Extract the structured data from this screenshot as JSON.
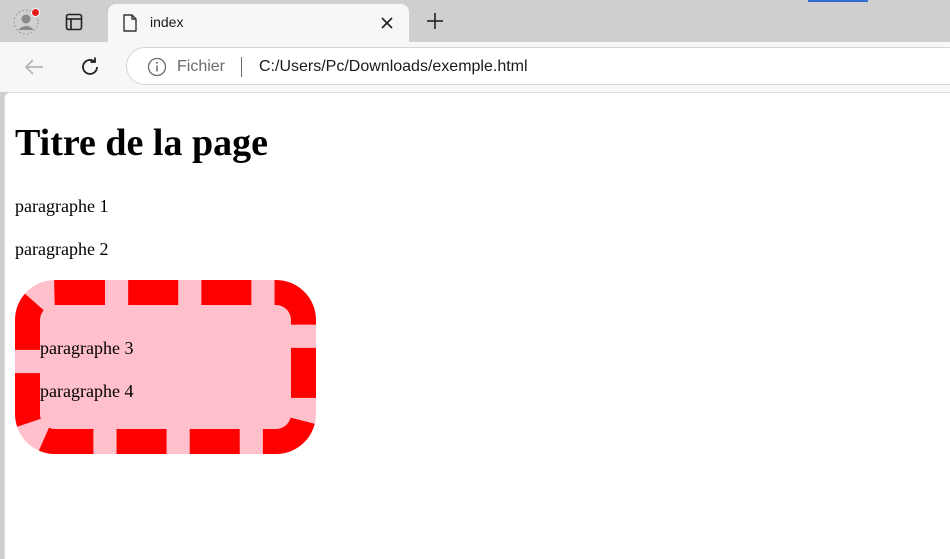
{
  "tab": {
    "title": "index"
  },
  "address_bar": {
    "site_label": "Fichier",
    "url": "C:/Users/Pc/Downloads/exemple.html"
  },
  "page": {
    "title": "Titre de la page",
    "paragraphs": [
      "paragraphe 1",
      "paragraphe 2"
    ],
    "box": {
      "paragraphs": [
        "paragraphe 3",
        "paragraphe 4"
      ],
      "background_color": "#ffc0cb",
      "border_color": "#ff0000"
    }
  },
  "icons": {
    "profile": "profile-icon",
    "tab_actions": "tab-actions-icon",
    "tab_page": "page-icon",
    "tab_close": "close-icon",
    "new_tab": "plus-icon",
    "back": "back-arrow-icon",
    "reload": "reload-icon",
    "info": "info-icon"
  },
  "colors": {
    "tabstrip_bg": "#cfcfcf",
    "toolbar_bg": "#f7f7f7",
    "notification_dot": "#e31b1b"
  }
}
